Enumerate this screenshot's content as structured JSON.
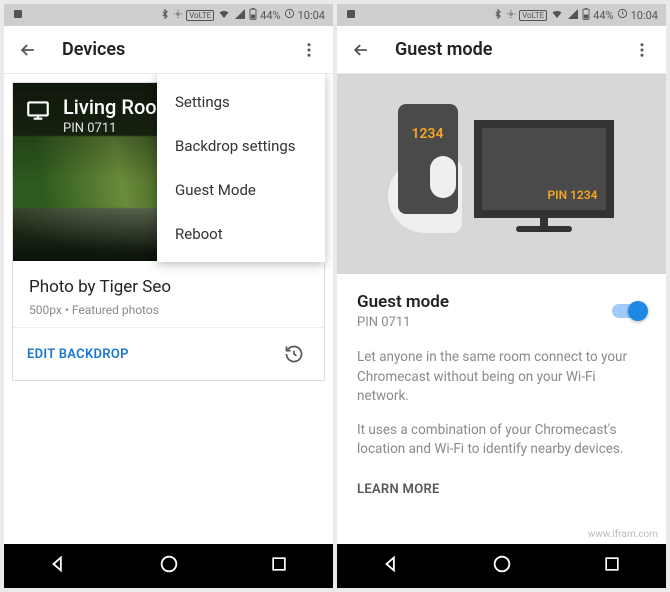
{
  "status": {
    "battery": "44%",
    "time": "10:04",
    "network_label": "VoLTE"
  },
  "left": {
    "appbar_title": "Devices",
    "device_name": "Living Room T",
    "device_pin": "PIN 0711",
    "menu": {
      "items": [
        "Settings",
        "Backdrop settings",
        "Guest Mode",
        "Reboot"
      ]
    },
    "photo_credit": "Photo by Tiger Seo",
    "photo_sub": "500px • Featured photos",
    "edit_backdrop": "EDIT BACKDROP"
  },
  "right": {
    "appbar_title": "Guest mode",
    "illus_phone_pin": "1234",
    "illus_tv_pin": "PIN 1234",
    "section_title": "Guest mode",
    "section_pin": "PIN 0711",
    "toggle_on": true,
    "desc1": "Let anyone in the same room connect to your Chromecast without being on your Wi-Fi network.",
    "desc2": "It uses a combination of your Chromecast's location and Wi-Fi to identify nearby devices.",
    "learn_more": "LEARN MORE"
  },
  "watermark": "www.ifram.com"
}
